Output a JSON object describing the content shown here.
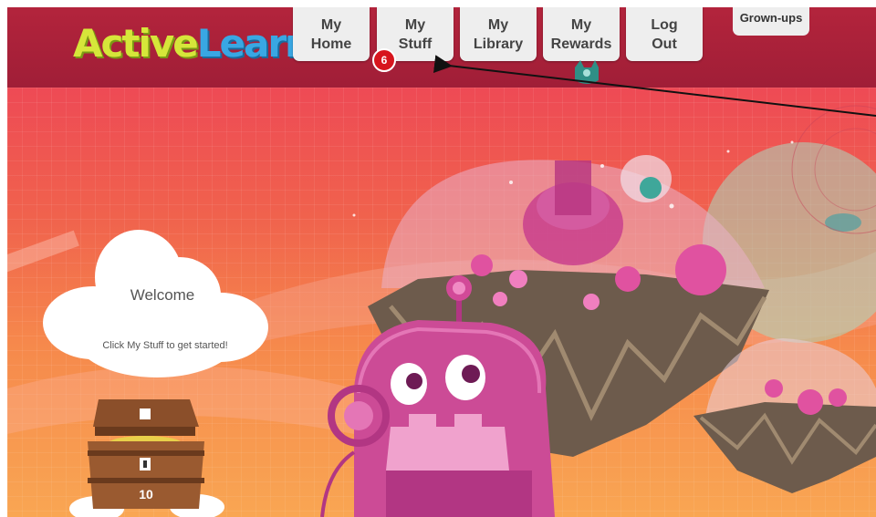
{
  "logo": {
    "part1": "Active",
    "part2": "Learn"
  },
  "nav": {
    "my_home": [
      "My",
      "Home"
    ],
    "my_stuff": [
      "My",
      "Stuff"
    ],
    "my_library": [
      "My",
      "Library"
    ],
    "my_rewards": [
      "My",
      "Rewards"
    ],
    "log_out": [
      "Log",
      "Out"
    ],
    "grown_ups": "Grown-ups",
    "stuff_badge": "6"
  },
  "welcome": {
    "title": "Welcome",
    "message": "Click My Stuff to get started!"
  },
  "treasure": {
    "count": "10"
  },
  "colors": {
    "header": "#a81f38",
    "nav_button": "#eeeeee",
    "badge": "#d7151d",
    "sky_top": "#ee4a55",
    "sky_bottom": "#f9a653"
  }
}
